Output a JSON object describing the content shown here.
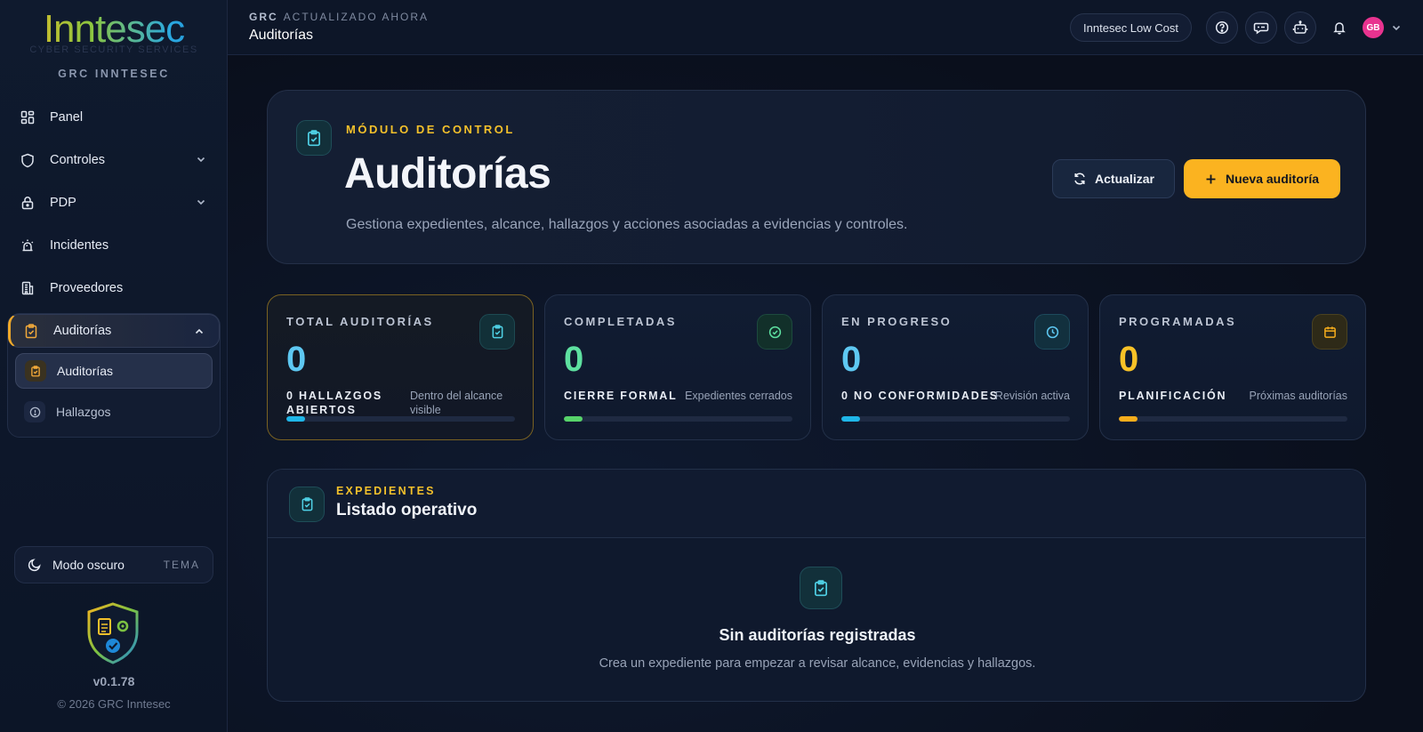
{
  "brand": {
    "logo": "Inntesec",
    "tagline": "CYBER SECURITY SERVICES",
    "app_name": "GRC INNTESEC"
  },
  "sidebar": {
    "items": [
      {
        "label": "Panel",
        "icon": "grid-icon"
      },
      {
        "label": "Controles",
        "icon": "shield-icon",
        "expandable": true
      },
      {
        "label": "PDP",
        "icon": "lock-icon",
        "expandable": true
      },
      {
        "label": "Incidentes",
        "icon": "siren-icon"
      },
      {
        "label": "Proveedores",
        "icon": "building-icon"
      }
    ],
    "group": {
      "label": "Auditorías",
      "icon": "clipboard-icon",
      "expanded": true,
      "children": [
        {
          "label": "Auditorías",
          "icon": "clipboard-icon",
          "active": true
        },
        {
          "label": "Hallazgos",
          "icon": "alert-circle-icon",
          "active": false
        }
      ]
    },
    "theme": {
      "label": "Modo oscuro",
      "tag": "TEMA"
    },
    "version": "v0.1.78",
    "copyright": "© 2026 GRC Inntesec"
  },
  "topbar": {
    "section": "GRC",
    "status": "ACTUALIZADO AHORA",
    "title": "Auditorías",
    "tenant": "Inntesec Low Cost",
    "avatar_initials": "GB",
    "icons": [
      "help-icon",
      "chat-icon",
      "robot-icon",
      "bell-icon"
    ]
  },
  "hero": {
    "eyebrow": "MÓDULO DE CONTROL",
    "title": "Auditorías",
    "description": "Gestiona expedientes, alcance, hallazgos y acciones asociadas a evidencias y controles.",
    "refresh_label": "Actualizar",
    "new_label": "Nueva auditoría"
  },
  "stats": [
    {
      "label": "TOTAL AUDITORÍAS",
      "value": "0",
      "foot_label": "0 HALLAZGOS ABIERTOS",
      "foot_note": "Dentro del alcance visible",
      "color": "#5ec8f2",
      "bar_color": "#1fb6e8",
      "progress": 0.08,
      "icon": "clipboard-check-icon"
    },
    {
      "label": "COMPLETADAS",
      "value": "0",
      "foot_label": "CIERRE FORMAL",
      "foot_note": "Expedientes cerrados",
      "color": "#5ee0a0",
      "bar_color": "#57d36a",
      "progress": 0.08,
      "icon": "check-circle-icon"
    },
    {
      "label": "EN PROGRESO",
      "value": "0",
      "foot_label": "0 NO CONFORMIDADES",
      "foot_note": "Revisión activa",
      "color": "#5ec8f2",
      "bar_color": "#1fb6e8",
      "progress": 0.08,
      "icon": "clock-icon"
    },
    {
      "label": "PROGRAMADAS",
      "value": "0",
      "foot_label": "PLANIFICACIÓN",
      "foot_note": "Próximas auditorías",
      "color": "#f8c227",
      "bar_color": "#f6ad1c",
      "progress": 0.08,
      "icon": "calendar-icon"
    }
  ],
  "panel": {
    "eyebrow": "EXPEDIENTES",
    "title": "Listado operativo",
    "empty_title": "Sin auditorías registradas",
    "empty_desc": "Crea un expediente para empezar a revisar alcance, evidencias y hallazgos."
  }
}
